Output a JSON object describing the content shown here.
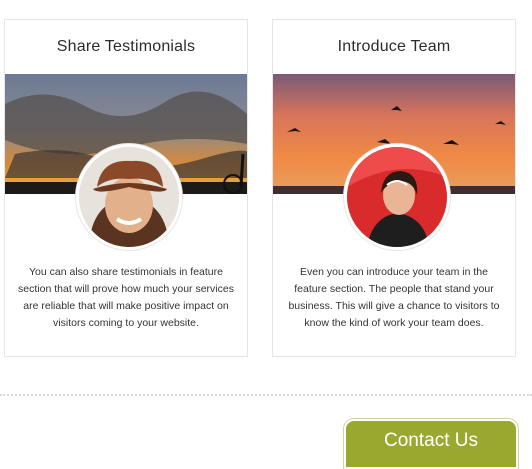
{
  "cards": [
    {
      "title": "Share Testimonials",
      "text": "You can also share testimonials in feature section that will prove how much your services are reliable that will make positive impact on visitors coming to your website."
    },
    {
      "title": "Introduce Team",
      "text": "Even you can introduce your team in the feature section. The people that stand your business. This will give a chance to visitors to know the kind of work your team does."
    }
  ],
  "contact_button": {
    "label": "Contact Us"
  },
  "colors": {
    "accent": "#9ba82f",
    "border": "#e6e6e6",
    "text": "#333333"
  },
  "icons": {
    "left_avatar": "woman-in-hat-photo",
    "right_avatar": "woman-with-umbrella-photo"
  }
}
